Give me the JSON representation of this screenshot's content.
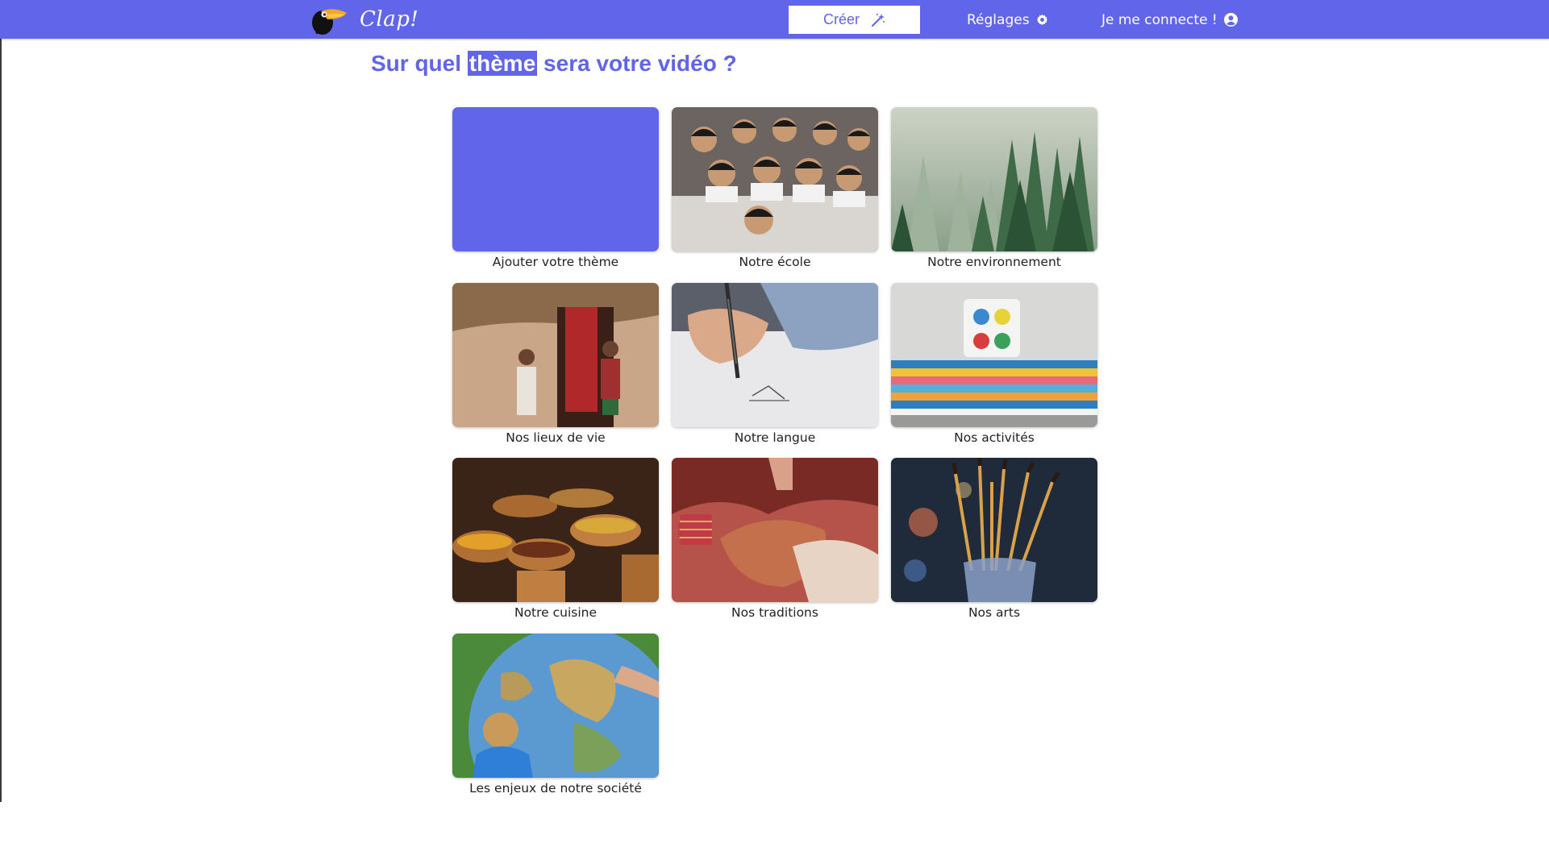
{
  "app": {
    "name": "Clap!"
  },
  "header": {
    "create_label": "Créer",
    "settings_label": "Réglages",
    "login_label": "Je me connecte !"
  },
  "page": {
    "title_before": "Sur quel",
    "title_highlight": "thème",
    "title_after": "sera votre vidéo ?"
  },
  "themes": [
    {
      "label": "Ajouter votre thème",
      "icon": "add-theme-placeholder"
    },
    {
      "label": "Notre école",
      "icon": "school-children-photo"
    },
    {
      "label": "Notre environnement",
      "icon": "forest-photo"
    },
    {
      "label": "Nos lieux de vie",
      "icon": "village-house-photo"
    },
    {
      "label": "Notre langue",
      "icon": "handwriting-photo"
    },
    {
      "label": "Nos activités",
      "icon": "books-mug-photo"
    },
    {
      "label": "Notre cuisine",
      "icon": "food-bowls-photo"
    },
    {
      "label": "Nos traditions",
      "icon": "henna-hands-photo"
    },
    {
      "label": "Nos arts",
      "icon": "paint-brushes-photo"
    },
    {
      "label": "Les enjeux de notre société",
      "icon": "globe-child-photo"
    }
  ],
  "colors": {
    "brand": "#6065ea",
    "header_text": "#ffffff",
    "label_text": "#222222"
  }
}
